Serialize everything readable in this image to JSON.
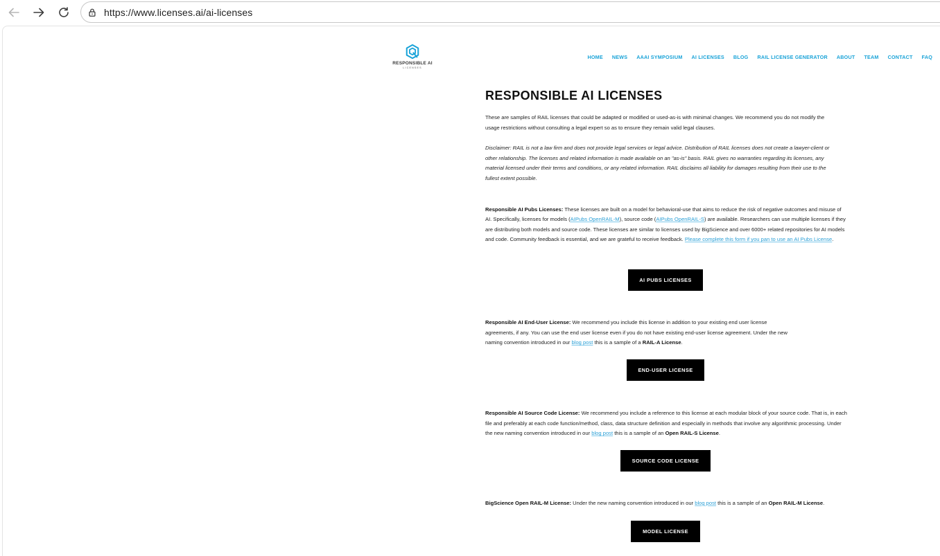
{
  "browser": {
    "url": "https://www.licenses.ai/ai-licenses"
  },
  "header": {
    "logo_name": "RESPONSIBLE AI",
    "logo_sub": "LICENSES",
    "nav": [
      "HOME",
      "NEWS",
      "AAAI SYMPOSIUM",
      "AI LICENSES",
      "BLOG",
      "RAIL LICENSE GENERATOR",
      "ABOUT",
      "TEAM",
      "CONTACT",
      "FAQ"
    ]
  },
  "main": {
    "title": "RESPONSIBLE AI LICENSES",
    "intro": "These are samples of RAIL licenses that could be adapted or modified or used-as-is with minimal changes. We recommend you do not modify the usage restrictions without consulting a legal expert so as to ensure they remain valid legal clauses.",
    "disclaimer": "Disclaimer: RAIL is not a law firm and does not provide legal services or legal advice. Distribution of RAIL licenses does not create a lawyer-client or other relationship. The licenses and related information is made available on an \"as-is\" basis. RAIL gives no warranties regarding its licenses, any material licensed under their terms and conditions, or any related information. RAIL disclaims all liability for damages resulting from their use to the fullest extent possible.",
    "pubs": {
      "heading": "Responsible AI Pubs Licenses:",
      "text1": " These licenses are built on a model for behavioral-use that aims to reduce the risk of negative outcomes and misuse of AI. Specifically, licenses for models (",
      "link_model": "AIPubs OpenRAIL-M",
      "text2": "), source code  (",
      "link_source": "AIPubs OpenRAIL-S",
      "text3": ") are available. Researchers can use multiple licenses if they are distributing both models and source code.  These licenses are similar to licenses used by BigScience and over 6000+ related repositories for AI models and code. Community feedback is essential, and we are grateful to receive feedback. ",
      "link_form": "Please complete this form if you pan to use an AI Pubs License",
      "text4": ".",
      "button": "AI PUBS LICENSES"
    },
    "enduser": {
      "heading": "Responsible AI End-User License:",
      "text1": " We recommend you include this license in addition to your existing end user license",
      "text2": "agreements, if any. You can use the end user license even if you do not have existing end-user license agreement. Under the new",
      "text3": "naming convention introduced in our ",
      "link_blog": "blog post",
      "text4": " this is a sample of a ",
      "bold_end": "RAIL-A License",
      "text5": ".",
      "button": "END-USER LICENSE"
    },
    "source": {
      "heading": "Responsible AI Source Code License:",
      "text1": " We recommend you include a reference to this license at each modular block of your source code. That is, in each file and preferably at each code function/method, class, data structure definition and especially in methods that involve any algorithmic processing. Under the new naming convention introduced in our ",
      "link_blog": "blog post",
      "text2": " this is a sample of an ",
      "bold_end": "Open RAIL-S License",
      "text3": ".",
      "button": "SOURCE CODE LICENSE"
    },
    "bigscience": {
      "heading": "BigScience Open RAIL-M License:",
      "text1": " Under the new naming convention introduced in our ",
      "link_blog": "blog post",
      "text2": " this is a sample of an ",
      "bold_end": "Open RAIL-M License",
      "text3": ".",
      "button": "MODEL LICENSE"
    }
  },
  "colors": {
    "accent": "#1aa3d8",
    "button_bg": "#000000"
  }
}
